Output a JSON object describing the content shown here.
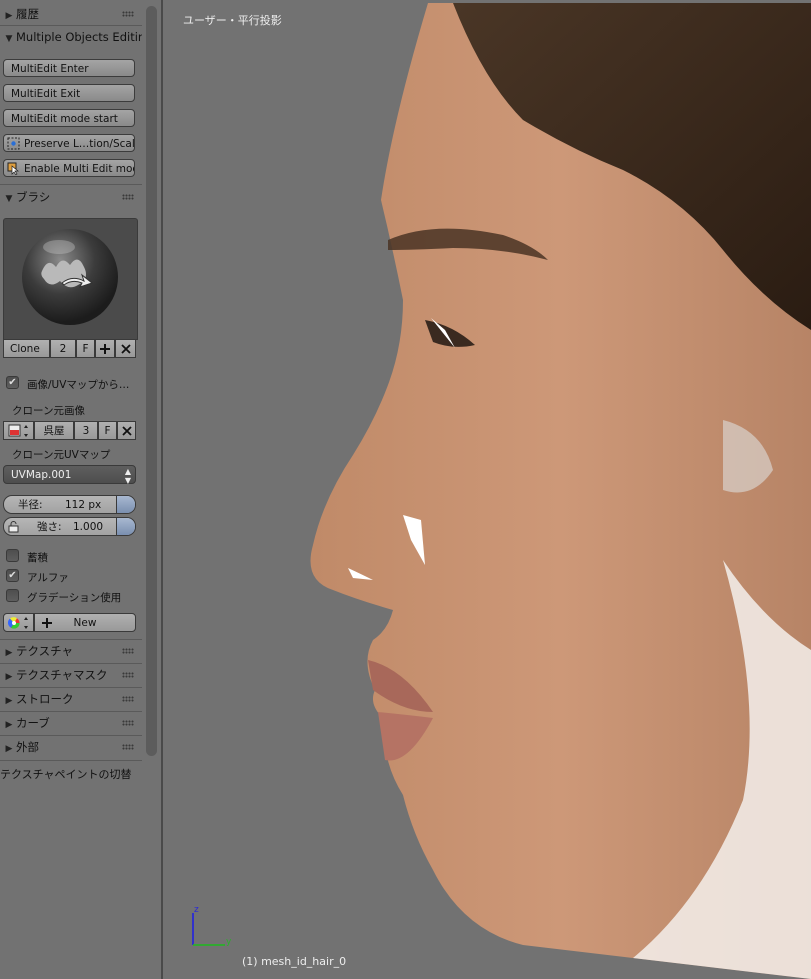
{
  "panel": {
    "history": {
      "label": "履歴"
    },
    "multi_edit": {
      "label": "Multiple Objects Editing",
      "buttons": [
        "MultiEdit Enter",
        "MultiEdit Exit",
        "MultiEdit mode start"
      ],
      "preserve": "Preserve L…tion/Scale",
      "enable": "Enable Multi Edit mode"
    },
    "brush": {
      "label": "ブラシ",
      "name": "Clone",
      "users": "2",
      "fake": "F",
      "option_uv": "画像/UVマップから…",
      "clone_image_label": "クローン元画像",
      "clone_image_name": "呉屋",
      "clone_image_users": "3",
      "clone_image_fake": "F",
      "clone_uv_label": "クローン元UVマップ",
      "clone_uv_value": "UVMap.001",
      "radius_label": "半径:",
      "radius_value": "112 px",
      "strength_label": "強さ:",
      "strength_value": "1.000",
      "accumulate": "蓄積",
      "alpha": "アルファ",
      "gradient": "グラデーション使用",
      "new_label": "New"
    },
    "checks": {
      "option_uv": true,
      "accumulate": false,
      "alpha": true,
      "gradient": false
    },
    "sections": [
      "テクスチャ",
      "テクスチャマスク",
      "ストローク",
      "カーブ",
      "外部"
    ],
    "toggle_label": "テクスチャペイントの切替"
  },
  "viewport": {
    "title": "ユーザー・平行投影",
    "object": "(1) mesh_id_hair_0",
    "axis_z": "z",
    "axis_y": "y"
  },
  "colors": {
    "viewport_bg": "#727272",
    "panel_bg": "#727272",
    "skin": "#c8926e",
    "hair": "#3b2a1e"
  }
}
